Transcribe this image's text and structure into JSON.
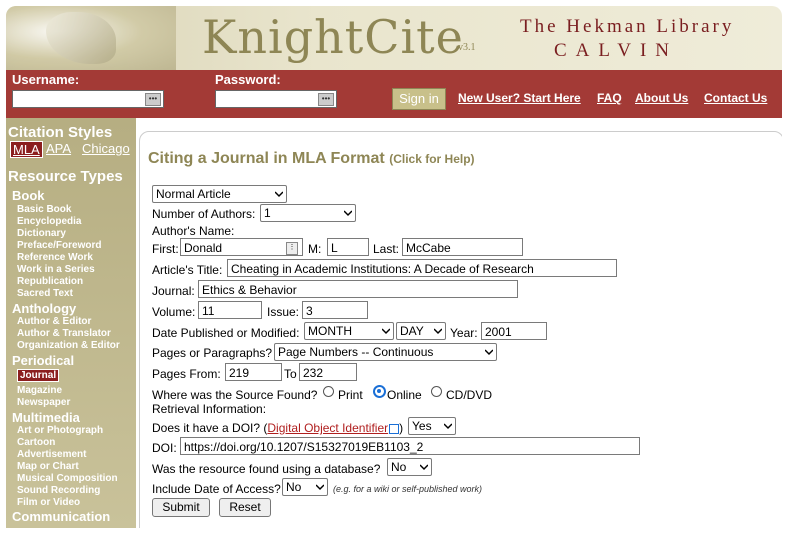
{
  "header": {
    "app_title": "KnightCite",
    "version": "v3.1",
    "library_line1": "The Hekman Library",
    "library_line2": "CALVIN"
  },
  "login": {
    "username_label": "Username:",
    "password_label": "Password:",
    "signin_label": "Sign in",
    "links": {
      "new_user": "New User? Start Here",
      "faq": "FAQ",
      "about": "About Us",
      "contact": "Contact Us"
    }
  },
  "sidebar": {
    "citation_styles": "Citation Styles",
    "styles": {
      "mla": "MLA",
      "apa": "APA",
      "chicago": "Chicago"
    },
    "resource_types": "Resource Types",
    "book": "Book",
    "book_items": [
      "Basic Book",
      "Encyclopedia",
      "Dictionary",
      "Preface/Foreword",
      "Reference Work",
      "Work in a Series",
      "Republication",
      "Sacred Text"
    ],
    "anthology": "Anthology",
    "anthology_items": [
      "Author & Editor",
      "Author & Translator",
      "Organization & Editor"
    ],
    "periodical": "Periodical",
    "periodical_items": [
      "Journal",
      "Magazine",
      "Newspaper"
    ],
    "multimedia": "Multimedia",
    "multimedia_items": [
      "Art or Photograph",
      "Cartoon",
      "Advertisement",
      "Map or Chart",
      "Musical Composition",
      "Sound Recording",
      "Film or Video"
    ],
    "communication": "Communication"
  },
  "form": {
    "title": "Citing a Journal in MLA Format",
    "help": "(Click for Help)",
    "article_type": "Normal Article",
    "num_authors_label": "Number of Authors:",
    "num_authors": "1",
    "authors_name_label": "Author's Name:",
    "first_label": "First:",
    "first": "Donald",
    "m_label": "M:",
    "m": "L",
    "last_label": "Last:",
    "last": "McCabe",
    "article_title_label": "Article's Title:",
    "article_title": "Cheating in Academic Institutions: A Decade of Research",
    "journal_label": "Journal:",
    "journal": "Ethics & Behavior",
    "volume_label": "Volume:",
    "volume": "11",
    "issue_label": "Issue:",
    "issue": "3",
    "date_label": "Date Published or Modified:",
    "month": "MONTH",
    "day": "DAY",
    "year_label": "Year:",
    "year": "2001",
    "pages_or_paragraphs_label": "Pages or Paragraphs?",
    "pages_or_paragraphs": "Page Numbers -- Continuous",
    "pages_from_label": "Pages From:",
    "pages_from": "219",
    "to_label": "To",
    "pages_to": "232",
    "source_label": "Where was the Source Found?",
    "source_options": {
      "print": "Print",
      "online": "Online",
      "cd": "CD/DVD"
    },
    "retrieval_label": "Retrieval Information:",
    "doi_q_prefix": "Does it have a DOI? (",
    "doi_q_link": "Digital Object Identifier",
    "doi_q_suffix": ")",
    "doi_has": "Yes",
    "doi_label": "DOI:",
    "doi": "https://doi.org/10.1207/S15327019EB1103_2",
    "database_label": "Was the resource found using a database?",
    "database": "No",
    "access_label": "Include Date of Access?",
    "access": "No",
    "access_note": "(e.g. for a wiki or self-published work)",
    "submit": "Submit",
    "reset": "Reset"
  },
  "colors": {
    "header_gold": "#8e8655",
    "bar_red": "#a33a36",
    "sidebar_tan": "#b6ae82",
    "active_red": "#8b1e1e"
  }
}
